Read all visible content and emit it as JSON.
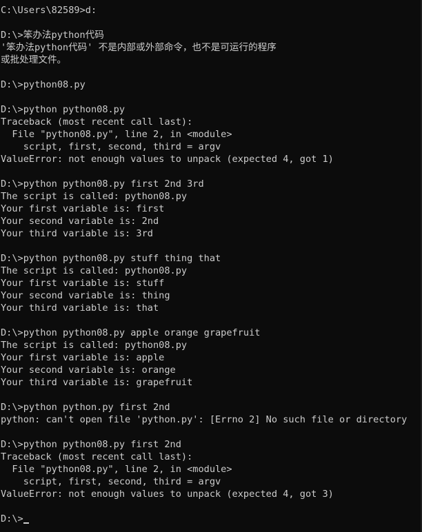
{
  "terminal": {
    "lines": [
      "C:\\Users\\82589>d:",
      "",
      "D:\\>笨办法python代码",
      "'笨办法python代码' 不是内部或外部命令，也不是可运行的程序",
      "或批处理文件。",
      "",
      "D:\\>python08.py",
      "",
      "D:\\>python python08.py",
      "Traceback (most recent call last):",
      "  File \"python08.py\", line 2, in <module>",
      "    script, first, second, third = argv",
      "ValueError: not enough values to unpack (expected 4, got 1)",
      "",
      "D:\\>python python08.py first 2nd 3rd",
      "The script is called: python08.py",
      "Your first variable is: first",
      "Your second variable is: 2nd",
      "Your third variable is: 3rd",
      "",
      "D:\\>python python08.py stuff thing that",
      "The script is called: python08.py",
      "Your first variable is: stuff",
      "Your second variable is: thing",
      "Your third variable is: that",
      "",
      "D:\\>python python08.py apple orange grapefruit",
      "The script is called: python08.py",
      "Your first variable is: apple",
      "Your second variable is: orange",
      "Your third variable is: grapefruit",
      "",
      "D:\\>python python.py first 2nd",
      "python: can't open file 'python.py': [Errno 2] No such file or directory",
      "",
      "D:\\>python python08.py first 2nd",
      "Traceback (most recent call last):",
      "  File \"python08.py\", line 2, in <module>",
      "    script, first, second, third = argv",
      "ValueError: not enough values to unpack (expected 4, got 3)",
      "",
      "D:\\>"
    ]
  }
}
